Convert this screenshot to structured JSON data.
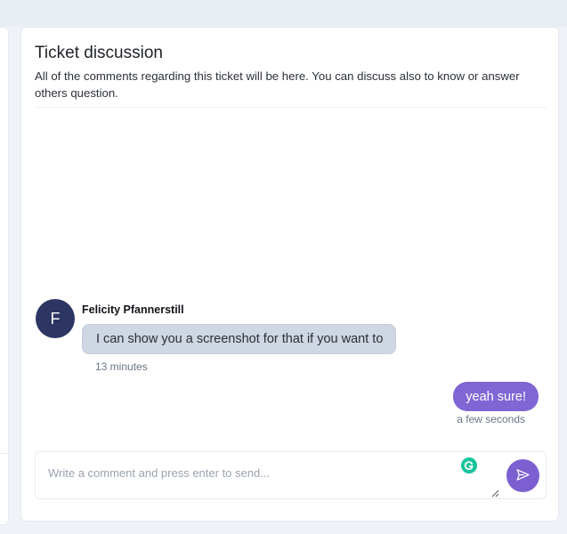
{
  "discussion": {
    "title": "Ticket discussion",
    "subtitle": "All of the comments regarding this ticket will be here. You can discuss also to know or answer others question."
  },
  "messages": [
    {
      "avatar_initial": "F",
      "sender": "Felicity Pfannerstill",
      "text": "I can show you a screenshot for that if you want to",
      "time": "13 minutes"
    },
    {
      "text": "yeah sure!",
      "time": "a few seconds"
    }
  ],
  "composer": {
    "placeholder": "Write a comment and press enter to send..."
  },
  "icons": {
    "send": "send-icon",
    "grammarly": "grammarly-icon",
    "resize": "resize-handle-icon"
  },
  "colors": {
    "accent": "#7c5fd0",
    "avatar_bg": "#2d3563",
    "incoming_bubble": "#cfd7e2",
    "grammarly": "#15c39a"
  }
}
